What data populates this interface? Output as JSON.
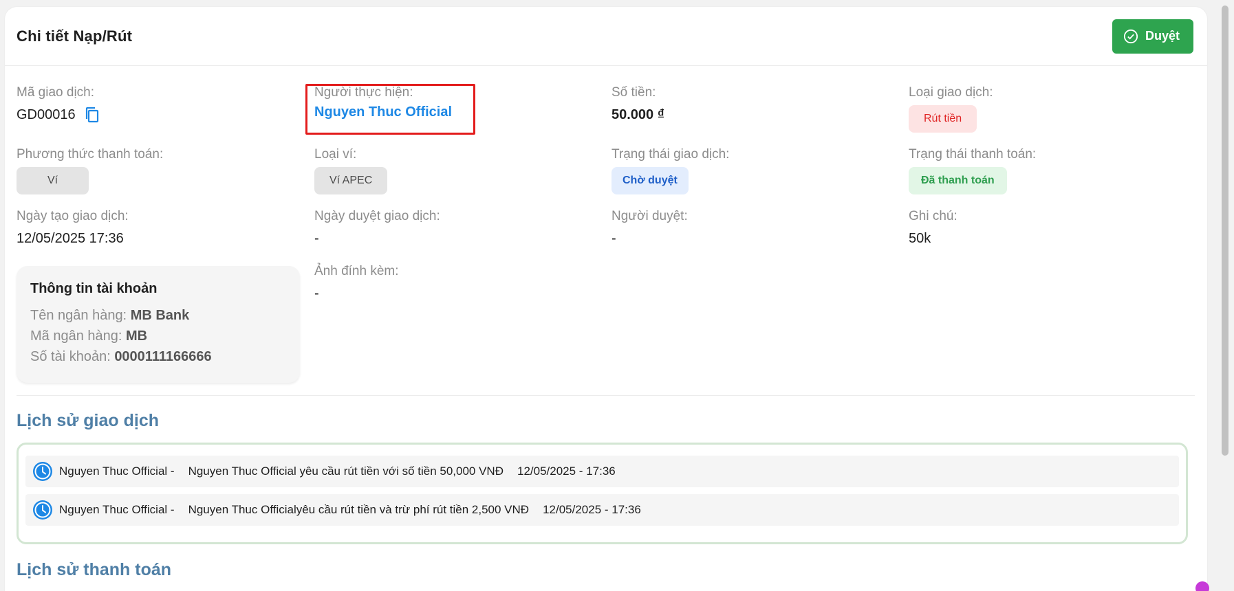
{
  "header": {
    "title": "Chi tiết Nạp/Rút",
    "approve_label": "Duyệt"
  },
  "fields": {
    "transaction_code": {
      "label": "Mã giao dịch:",
      "value": "GD00016"
    },
    "performer": {
      "label": "Người thực hiện:",
      "value": "Nguyen Thuc Official"
    },
    "amount": {
      "label": "Số tiền:",
      "value": "50.000 ₫"
    },
    "transaction_type": {
      "label": "Loại giao dịch:",
      "value": "Rút tiền"
    },
    "payment_method": {
      "label": "Phương thức thanh toán:",
      "value": "Ví"
    },
    "wallet_type": {
      "label": "Loại ví:",
      "value": "Ví APEC"
    },
    "transaction_status": {
      "label": "Trạng thái giao dịch:",
      "value": "Chờ duyệt"
    },
    "payment_status": {
      "label": "Trạng thái thanh toán:",
      "value": "Đã thanh toán"
    },
    "created_at": {
      "label": "Ngày tạo giao dịch:",
      "value": "12/05/2025 17:36"
    },
    "approved_at": {
      "label": "Ngày duyệt giao dịch:",
      "value": "-"
    },
    "approver": {
      "label": "Người duyệt:",
      "value": "-"
    },
    "note": {
      "label": "Ghi chú:",
      "value": "50k"
    },
    "attachment": {
      "label": "Ảnh đính kèm:",
      "value": "-"
    }
  },
  "account": {
    "title": "Thông tin tài khoản",
    "bank_name_label": "Tên ngân hàng:",
    "bank_name": "MB Bank",
    "bank_code_label": "Mã ngân hàng:",
    "bank_code": "MB",
    "account_no_label": "Số tài khoản:",
    "account_no": "0000111166666"
  },
  "history": {
    "title": "Lịch sử giao dịch",
    "items": [
      {
        "actor": "Nguyen Thuc Official -",
        "message": "Nguyen Thuc Official yêu cầu rút tiền với số tiền 50,000 VNĐ",
        "time": "12/05/2025 - 17:36"
      },
      {
        "actor": "Nguyen Thuc Official -",
        "message": "Nguyen Thuc Officialyêu cầu rút tiền và trừ phí rút tiền 2,500 VNĐ",
        "time": "12/05/2025 - 17:36"
      }
    ]
  },
  "payment_history": {
    "title": "Lịch sử thanh toán"
  },
  "colors": {
    "accent": "#1e88e5",
    "approve": "#2ea44f",
    "highlight": "#e31c1c",
    "section": "#4f7fa6"
  },
  "icons": {
    "approve": "check-circle-icon",
    "copy": "copy-icon",
    "history": "clock-icon"
  }
}
